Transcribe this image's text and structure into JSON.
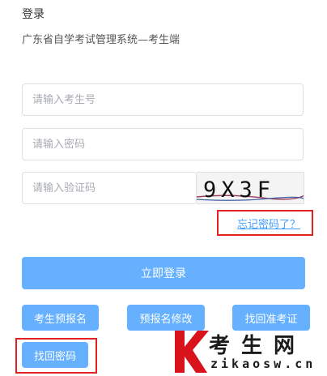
{
  "header": {
    "title": "登录",
    "subtitle": "广东省自学考试管理系统—考生端"
  },
  "form": {
    "exam_number_placeholder": "请输入考生号",
    "password_placeholder": "请输入密码",
    "captcha_placeholder": "请输入验证码",
    "captcha_text": "9X3F",
    "forgot_password": "忘记密码了？",
    "login_button": "立即登录"
  },
  "actions": {
    "pre_register": "考生预报名",
    "modify_pre_register": "预报名修改",
    "retrieve_admission": "找回准考证",
    "retrieve_password": "找回密码"
  },
  "watermark": {
    "brand_cn": "考生网",
    "brand_url": "zikaosw.cn"
  },
  "colors": {
    "primary_button": "#66b1ff",
    "link": "#409eff",
    "highlight_border": "#e02222",
    "watermark_red": "#d8131b"
  }
}
